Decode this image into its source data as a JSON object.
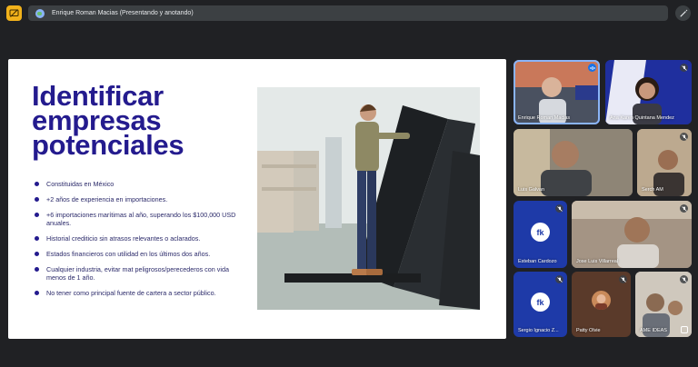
{
  "meeting": {
    "presenter_banner": "Enrique Roman Macias (Presentando y anotando)",
    "accent": "#f2b21b"
  },
  "slide": {
    "title_lines": [
      "Identificar",
      "empresas",
      "potenciales"
    ],
    "title_color": "#241b8e",
    "bullets": [
      "Constituidas en México",
      "+2 años de experiencia en importaciones.",
      "+6 importaciones marítimas al año, superando los $100,000 USD anuales.",
      "Historial crediticio sin atrasos relevantes o aclarados.",
      "Estados financieros con utilidad en los últimos dos años.",
      "Cualquier industria, evitar mat peligrosos/perecederos con vida menos de 1 año.",
      "No tener como principal fuente de cartera a sector público."
    ]
  },
  "participants": [
    {
      "name": "Enrique Roman Macias",
      "speaking": true,
      "camera": true
    },
    {
      "name": "Ana Karen Quintana Mendez",
      "camera": true,
      "muted": true
    },
    {
      "name": "Luis Galvan",
      "camera": true
    },
    {
      "name": "Serch AM",
      "camera": true,
      "muted": true
    },
    {
      "name": "Esteban Cardozo",
      "camera": false,
      "muted": true
    },
    {
      "name": "Jose Luis Villarreal",
      "camera": true,
      "muted": true
    },
    {
      "name": "Sergio Ignacio Z...",
      "camera": false,
      "muted": true
    },
    {
      "name": "Patty Olvie",
      "camera": false,
      "muted": true
    },
    {
      "name": "AME IDEAS",
      "camera": true,
      "muted": true
    }
  ]
}
